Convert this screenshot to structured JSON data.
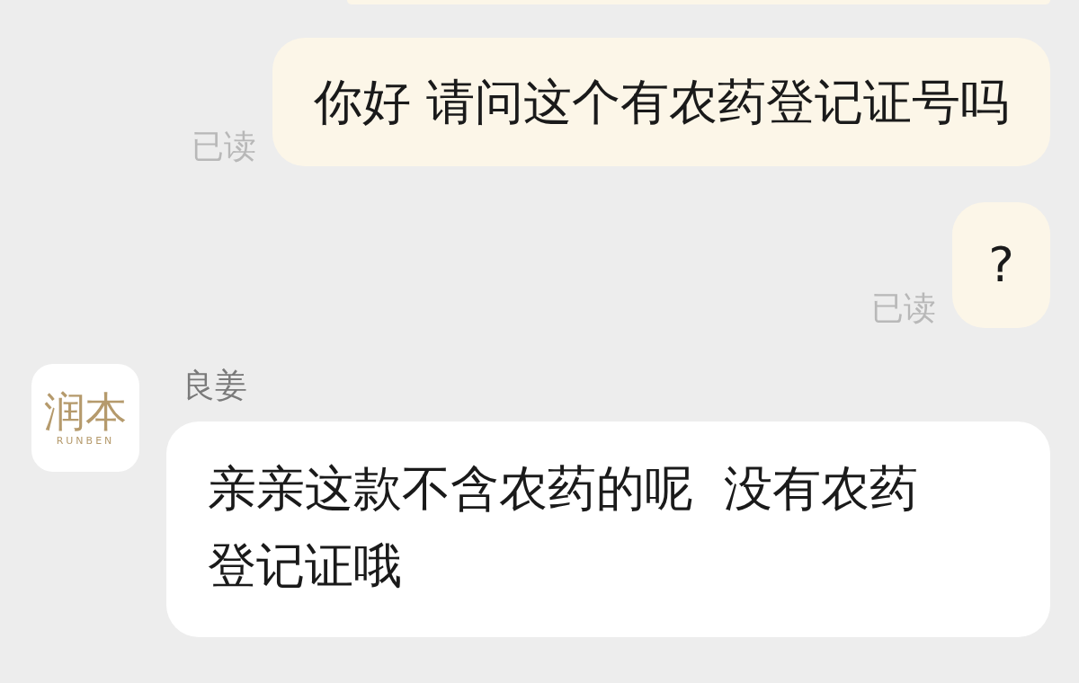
{
  "messages": [
    {
      "kind": "outgoing",
      "text": "你好 请问这个有农药登记证号吗",
      "read_label": "已读"
    },
    {
      "kind": "outgoing",
      "text": "?",
      "read_label": "已读"
    },
    {
      "kind": "incoming",
      "sender": "良姜",
      "avatar": {
        "logo": "润本",
        "subtitle": "RUNBEN"
      },
      "text": "亲亲这款不含农药的呢  没有农药登记证哦"
    }
  ]
}
